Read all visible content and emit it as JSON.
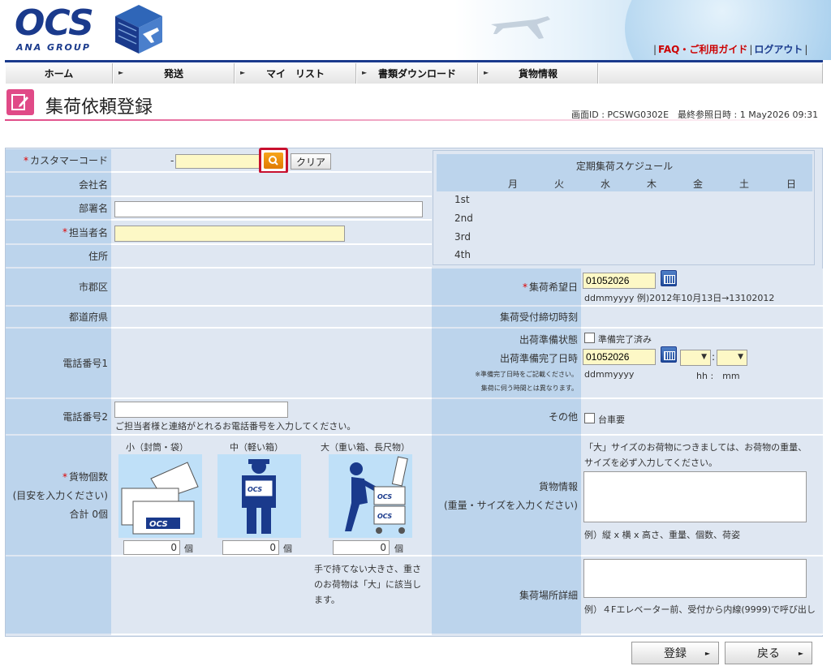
{
  "header": {
    "logo": "OCS",
    "logo_group": "ANA GROUP",
    "links": {
      "faq": "FAQ・ご利用ガイド",
      "logout": "ログアウト"
    }
  },
  "nav": {
    "items": [
      "ホーム",
      "発送",
      "マイ　リスト",
      "書類ダウンロード",
      "貨物情報"
    ]
  },
  "page": {
    "title": "集荷依頼登録",
    "screen_id": "画面ID : PCSWG0302E　最終参照日時 : 1 May2026 09:31"
  },
  "form": {
    "customer_code_label": "カスタマーコード",
    "customer_code_prefix": "-",
    "clear_label": "クリア",
    "company_label": "会社名",
    "department_label": "部署名",
    "contact_label": "担当者名",
    "address_label": "住所",
    "city_label": "市郡区",
    "prefecture_label": "都道府県",
    "phone1_label": "電話番号1",
    "phone2_label": "電話番号2",
    "phone2_note": "ご担当者様と連絡がとれるお電話番号を入力してください。",
    "pieces_label": "貨物個数",
    "pieces_note": "(目安を入力ください)",
    "pieces_total": "合計 0個",
    "small_label": "小（封筒・袋）",
    "medium_label": "中（軽い箱）",
    "large_label": "大（重い箱、長尺物）",
    "small_qty": "0",
    "medium_qty": "0",
    "large_qty": "0",
    "unit": "個",
    "large_note": "手で持てない大きさ、重さのお荷物は「大」に該当します。",
    "pickup_date_label": "集荷希望日",
    "pickup_date_value": "01052026",
    "pickup_date_hint": "ddmmyyyy 例)2012年10月13日→13102012",
    "cutoff_label": "集荷受付締切時刻",
    "prep_status_label": "出荷準備状態",
    "prep_done_label": "準備完了済み",
    "prep_time_label": "出荷準備完了日時",
    "prep_date_value": "01052026",
    "prep_note1": "※準備完了日時をご記載ください。",
    "prep_note2": "集荷に伺う時間とは異なります。",
    "prep_hint_date": "ddmmyyyy",
    "prep_hint_time": "hh :　mm",
    "time_sep": ":",
    "other_label": "その他",
    "truck_label": "台車要",
    "cargo_info_label": "貨物情報",
    "cargo_info_note": "(重量・サイズを入力ください)",
    "cargo_info_desc": "「大」サイズのお荷物につきましては、お荷物の重量、サイズを必ず入力してください。",
    "cargo_info_example": "例）縦 x 横 x 高さ、重量、個数、荷姿",
    "pickup_place_label": "集荷場所詳細",
    "pickup_place_example": "例）４Fエレベーター前、受付から内線(9999)で呼び出し"
  },
  "schedule": {
    "title": "定期集荷スケジュール",
    "days": [
      "月",
      "火",
      "水",
      "木",
      "金",
      "土",
      "日"
    ],
    "weeks": [
      "1st",
      "2nd",
      "3rd",
      "4th"
    ]
  },
  "buttons": {
    "register": "登録",
    "back": "戻る"
  },
  "colors": {
    "brand": "#1a3a8c",
    "accent": "#e04a87",
    "label_bg": "#bcd4ec",
    "required": "#d00000",
    "input_required": "#fdf8c6"
  }
}
